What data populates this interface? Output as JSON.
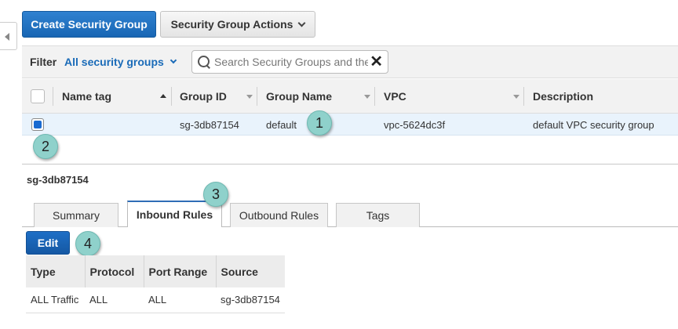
{
  "toolbar": {
    "create_label": "Create Security Group",
    "actions_label": "Security Group Actions"
  },
  "filter": {
    "label": "Filter",
    "selected": "All security groups",
    "search_placeholder": "Search Security Groups and their properties"
  },
  "table": {
    "columns": [
      "Name tag",
      "Group ID",
      "Group Name",
      "VPC",
      "Description"
    ],
    "rows": [
      {
        "checked": true,
        "name_tag": "",
        "group_id": "sg-3db87154",
        "group_name": "default",
        "vpc": "vpc-5624dc3f",
        "description": "default VPC security group"
      }
    ]
  },
  "details": {
    "title": "sg-3db87154",
    "tabs": [
      "Summary",
      "Inbound Rules",
      "Outbound Rules",
      "Tags"
    ],
    "active_tab": "Inbound Rules",
    "edit_label": "Edit",
    "rules_columns": [
      "Type",
      "Protocol",
      "Port Range",
      "Source"
    ],
    "rules": [
      {
        "type": "ALL Traffic",
        "protocol": "ALL",
        "port_range": "ALL",
        "source": "sg-3db87154"
      }
    ]
  },
  "callouts": [
    "1",
    "2",
    "3",
    "4"
  ],
  "colors": {
    "primary_button": "#1866b4",
    "link_blue": "#1a6bb8",
    "selected_row": "#e9f3fc",
    "callout": "#8fd1cb"
  },
  "icons": {
    "collapse": "chevron-left-icon",
    "search": "search-icon",
    "clear": "close-icon",
    "dropdown": "chevron-down-icon"
  }
}
